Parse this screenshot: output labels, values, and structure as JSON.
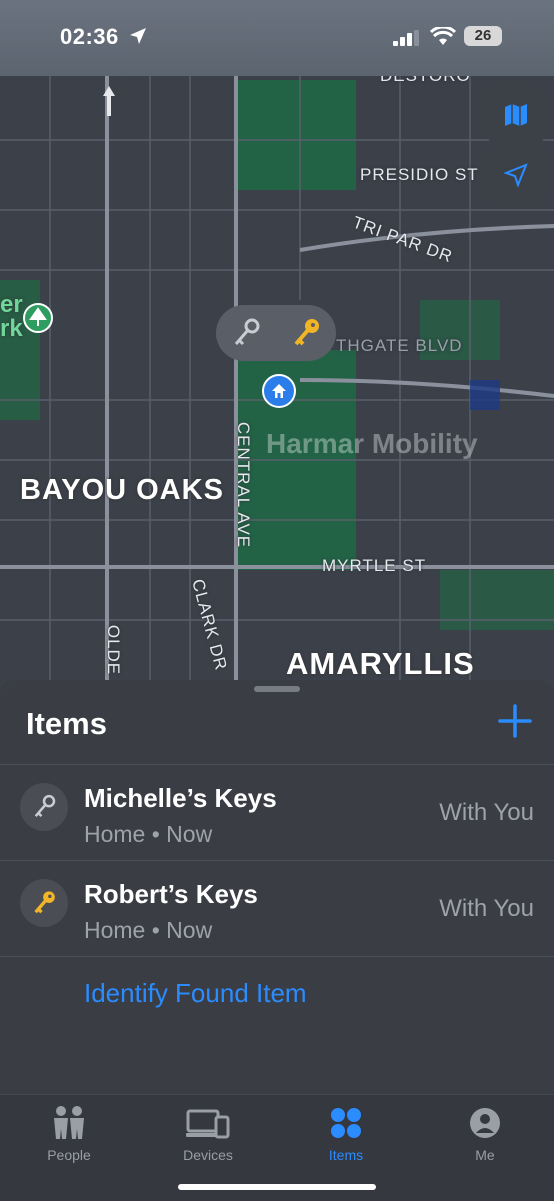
{
  "status_bar": {
    "time": "02:36",
    "battery": "26"
  },
  "map": {
    "labels": {
      "bayou_oaks": "BAYOU OAKS",
      "amaryllis": "AMARYLLIS",
      "presidio": "PRESIDIO ST",
      "tri_par": "TRI PAR DR",
      "central": "CENTRAL AVE",
      "myrtle": "MYRTLE ST",
      "clark": "CLARK DR",
      "olde": "OLDE",
      "southgate": "THGATE BLVD",
      "destoro": "DESTORO",
      "park_partial": "er\nrk"
    },
    "watermark": "Harmar Mobility"
  },
  "sheet": {
    "title": "Items",
    "items": [
      {
        "name": "Michelle’s Keys",
        "subtitle": "Home • Now",
        "status": "With You",
        "icon": "key-icon-gray"
      },
      {
        "name": "Robert’s Keys",
        "subtitle": "Home • Now",
        "status": "With You",
        "icon": "key-icon-gold"
      }
    ],
    "identify_link": "Identify Found Item"
  },
  "tabbar": {
    "tabs": [
      {
        "label": "People",
        "icon": "people-icon"
      },
      {
        "label": "Devices",
        "icon": "devices-icon"
      },
      {
        "label": "Items",
        "icon": "items-icon",
        "active": true
      },
      {
        "label": "Me",
        "icon": "person-icon"
      }
    ]
  },
  "colors": {
    "accent": "#2b8cff",
    "park": "#1f6a45",
    "water": "#1e3a86"
  }
}
